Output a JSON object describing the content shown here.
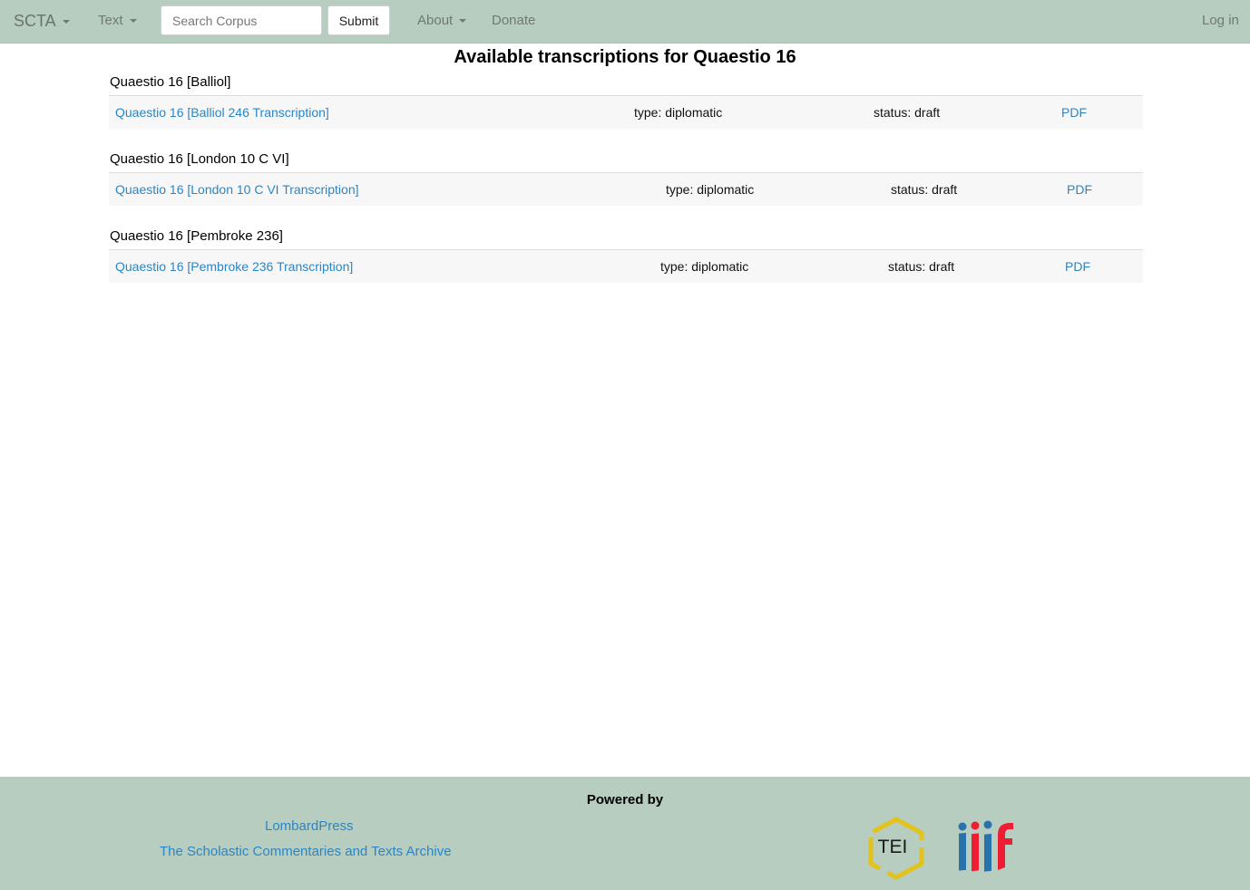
{
  "nav": {
    "brand": "SCTA",
    "text_menu": "Text",
    "search_placeholder": "Search Corpus",
    "submit_label": "Submit",
    "about_menu": "About",
    "donate": "Donate",
    "login": "Log in"
  },
  "main": {
    "title": "Available transcriptions for Quaestio 16",
    "sections": [
      {
        "heading": "Quaestio 16 [Balliol]",
        "link": "Quaestio 16 [Balliol 246 Transcription]",
        "type": "type: diplomatic",
        "status": "status: draft",
        "pdf": "PDF"
      },
      {
        "heading": "Quaestio 16 [London 10 C VI]",
        "link": "Quaestio 16 [London 10 C VI Transcription]",
        "type": "type: diplomatic",
        "status": "status: draft",
        "pdf": "PDF"
      },
      {
        "heading": "Quaestio 16 [Pembroke 236]",
        "link": "Quaestio 16 [Pembroke 236 Transcription]",
        "type": "type: diplomatic",
        "status": "status: draft",
        "pdf": "PDF"
      }
    ]
  },
  "footer": {
    "powered_by": "Powered by",
    "lombardpress": "LombardPress",
    "scta_archive": "The Scholastic Commentaries and Texts Archive",
    "tei_logo_text": "TEI",
    "iiif_logo_text": "iiif"
  },
  "colors": {
    "navbar_bg": "#b7cdbf",
    "link": "#2a86c7",
    "row_bg": "#f7f7f7",
    "tei_yellow": "#e3c21c",
    "iiif_blue": "#2873ab",
    "iiif_red": "#ed1d33"
  }
}
